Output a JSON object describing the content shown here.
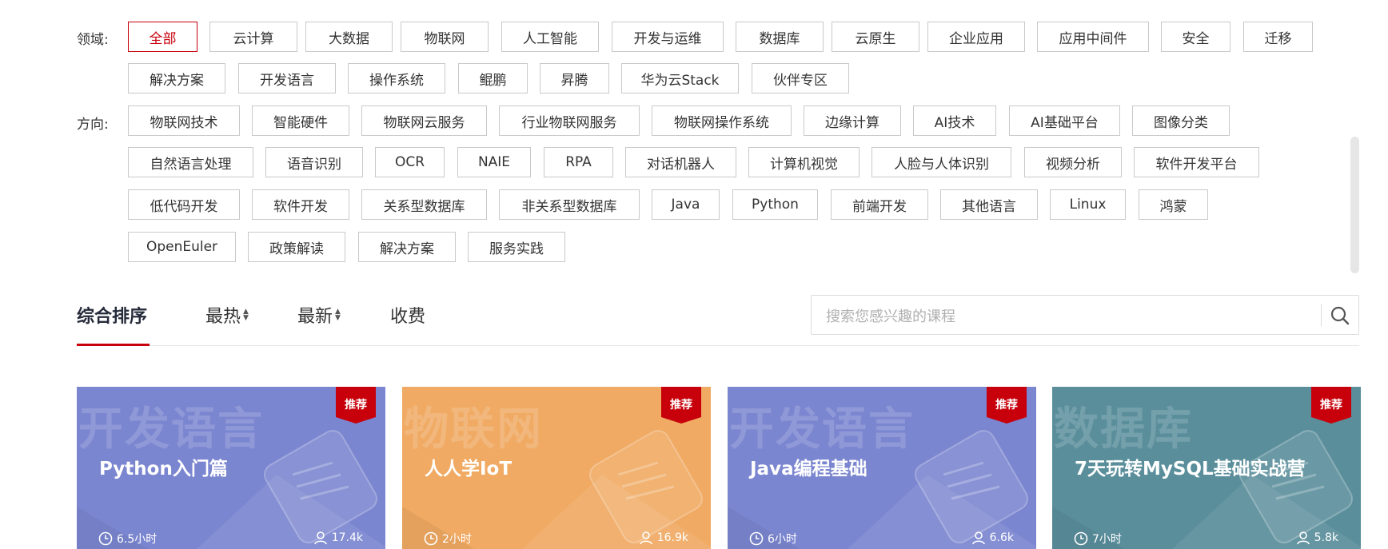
{
  "filters": {
    "domain_label": "领域:",
    "domain_tags": [
      "全部",
      "云计算",
      "大数据",
      "物联网",
      "人工智能",
      "开发与运维",
      "数据库",
      "云原生",
      "企业应用",
      "应用中间件",
      "安全",
      "迁移",
      "解决方案",
      "开发语言",
      "操作系统",
      "鲲鹏",
      "昇腾",
      "华为云Stack",
      "伙伴专区"
    ],
    "direction_label": "方向:",
    "direction_tags": [
      "物联网技术",
      "智能硬件",
      "物联网云服务",
      "行业物联网服务",
      "物联网操作系统",
      "边缘计算",
      "AI技术",
      "AI基础平台",
      "图像分类",
      "自然语言处理",
      "语音识别",
      "OCR",
      "NAIE",
      "RPA",
      "对话机器人",
      "计算机视觉",
      "人脸与人体识别",
      "视频分析",
      "软件开发平台",
      "低代码开发",
      "软件开发",
      "关系型数据库",
      "非关系型数据库",
      "Java",
      "Python",
      "前端开发",
      "其他语言",
      "Linux",
      "鸿蒙",
      "OpenEuler",
      "政策解读",
      "解决方案",
      "服务实践"
    ]
  },
  "sort": {
    "comprehensive": "综合排序",
    "hottest": "最热",
    "newest": "最新",
    "paid": "收费"
  },
  "search": {
    "placeholder": "搜索您感兴趣的课程"
  },
  "courses": [
    {
      "bg_text": "开发语言",
      "title": "Python入门篇",
      "badge": "推荐",
      "duration": "6.5小时",
      "learners": "17.4k",
      "color": "#7b86d0"
    },
    {
      "bg_text": "物联网",
      "title": "人人学IoT",
      "badge": "推荐",
      "duration": "2小时",
      "learners": "16.9k",
      "color": "#f0aa63"
    },
    {
      "bg_text": "开发语言",
      "title": "Java编程基础",
      "badge": "推荐",
      "duration": "6小时",
      "learners": "6.6k",
      "color": "#7b86d0"
    },
    {
      "bg_text": "数据库",
      "title": "7天玩转MySQL基础实战营",
      "badge": "推荐",
      "duration": "7小时",
      "learners": "5.8k",
      "color": "#5a8e9b"
    }
  ],
  "colors": {
    "accent": "#c7000b",
    "badge": "#c7000b"
  }
}
